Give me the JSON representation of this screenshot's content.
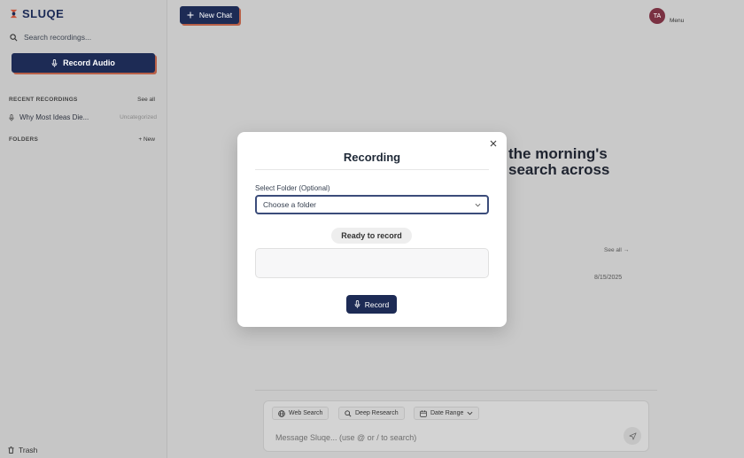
{
  "sidebar": {
    "logo_text": "SLUQE",
    "search_placeholder": "Search recordings...",
    "record_button": "Record Audio",
    "recent_title": "RECENT RECORDINGS",
    "recent_action": "See all",
    "recent_items": [
      {
        "title": "Why Most Ideas Die...",
        "category": "Uncategorized"
      }
    ],
    "folders_title": "FOLDERS",
    "folders_action": "+ New",
    "trash_label": "Trash"
  },
  "header": {
    "new_chat_label": "New Chat",
    "avatar_initials": "TA",
    "menu_label": "Menu"
  },
  "background": {
    "hero_line1": "the morning's",
    "hero_line2": "search across",
    "see_all": "See all",
    "date": "8/15/2025"
  },
  "composer": {
    "tools": [
      "Web Search",
      "Deep Research",
      "Date Range"
    ],
    "placeholder": "Message Sluqe... (use @ or / to search)"
  },
  "modal": {
    "title": "Recording",
    "folder_label": "Select Folder (Optional)",
    "folder_selected": "Choose a folder",
    "status": "Ready to record",
    "record_button": "Record"
  },
  "colors": {
    "brand_navy": "#1d2b55",
    "accent_shadow": "#b86048",
    "avatar": "#7a3142"
  },
  "icons": [
    "logo-icon",
    "search-icon",
    "microphone-icon",
    "plus-icon",
    "trash-icon",
    "globe-icon",
    "calendar-icon",
    "chevron-down-icon",
    "arrow-right-icon",
    "send-icon",
    "close-icon"
  ]
}
